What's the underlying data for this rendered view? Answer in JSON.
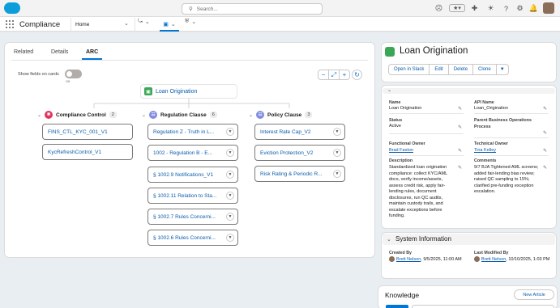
{
  "header": {
    "search_placeholder": "Search...",
    "icons": [
      "salesforce-logo",
      "search-icon",
      "assistant-icon",
      "favorites-star-icon",
      "favorites-dropdown-icon",
      "global-actions-icon",
      "setup-gear-icon",
      "help-icon",
      "bell-icon",
      "avatar"
    ]
  },
  "nav": {
    "app_name": "Compliance",
    "tab_label": "Home",
    "icons": [
      "waffle-icon",
      "chevron-down-icon",
      "hierarchy-icon",
      "chevron-down-icon",
      "record-icon",
      "chevron-down-icon",
      "shield-icon",
      "chevron-down-icon"
    ]
  },
  "left": {
    "tabs": [
      "Related",
      "Details",
      "ARC"
    ],
    "active_tab": "ARC",
    "show_fields_label": "Show fields on cards",
    "toggle_state": "Off",
    "zoom_buttons": [
      "−",
      "⤢",
      "+"
    ],
    "refresh_icon": "refresh-icon",
    "root": {
      "label": "Loan Origination",
      "color": "#3ba755"
    },
    "groups": [
      {
        "title": "Compliance Control",
        "count": "2",
        "color": "#e0365e",
        "items": [
          "FINS_CTL_KYC_001_V1",
          "KycRefreshControl_V1"
        ]
      },
      {
        "title": "Regulation Clause",
        "count": "6",
        "color": "#7f8de1",
        "items": [
          "Regulation Z - Truth in L...",
          "1002 - Regulation B - E...",
          "§ 1002.9 Notifications_V1",
          "§ 1002.11 Relation to Sta...",
          "§ 1002.7 Rules Concerni...",
          "§ 1002.6 Rules Concerni..."
        ]
      },
      {
        "title": "Policy Clause",
        "count": "3",
        "color": "#7f8de1",
        "items": [
          "Interest Rate Cap_V2",
          "Eviction Protection_V2",
          "Risk Rating & Periodic R..."
        ]
      }
    ]
  },
  "record": {
    "title": "Loan Origination",
    "icon_color": "#3ba755",
    "actions": [
      "Open in Slack",
      "Edit",
      "Delete",
      "Clone"
    ],
    "fields": {
      "name_label": "Name",
      "name_value": "Loan Origination",
      "api_label": "API Name",
      "api_value": "Loan_Origination",
      "status_label": "Status",
      "status_value": "Active",
      "parent_label": "Parent Business Operations Process",
      "func_owner_label": "Functional Owner",
      "func_owner_value": "Brad Faxton",
      "tech_owner_label": "Technical Owner",
      "tech_owner_value": "Tina Kelley",
      "desc_label": "Description",
      "desc_value": "Standardized loan origination compliance: collect KYC/AML docs, verify income/assets, assess credit risk, apply fair-lending rules, document disclosures, run QC audits, maintain custody trails, and escalate exceptions before funding.",
      "comments_label": "Comments",
      "comments_value": "9/7 BJA Tightened AML screens; added fair-lending bias review; raised QC sampling to 15%; clarified pre-funding exception escalation."
    },
    "system": {
      "title": "System Information",
      "created_label": "Created By",
      "created_user": "Brett Nelson",
      "created_date": ", 9/5/2025, 11:00 AM",
      "modified_label": "Last Modified By",
      "modified_user": "Brett Nelson",
      "modified_date": ", 10/10/2025, 1:03 PM"
    },
    "knowledge": {
      "title": "Knowledge",
      "new_article": "New Article"
    }
  }
}
